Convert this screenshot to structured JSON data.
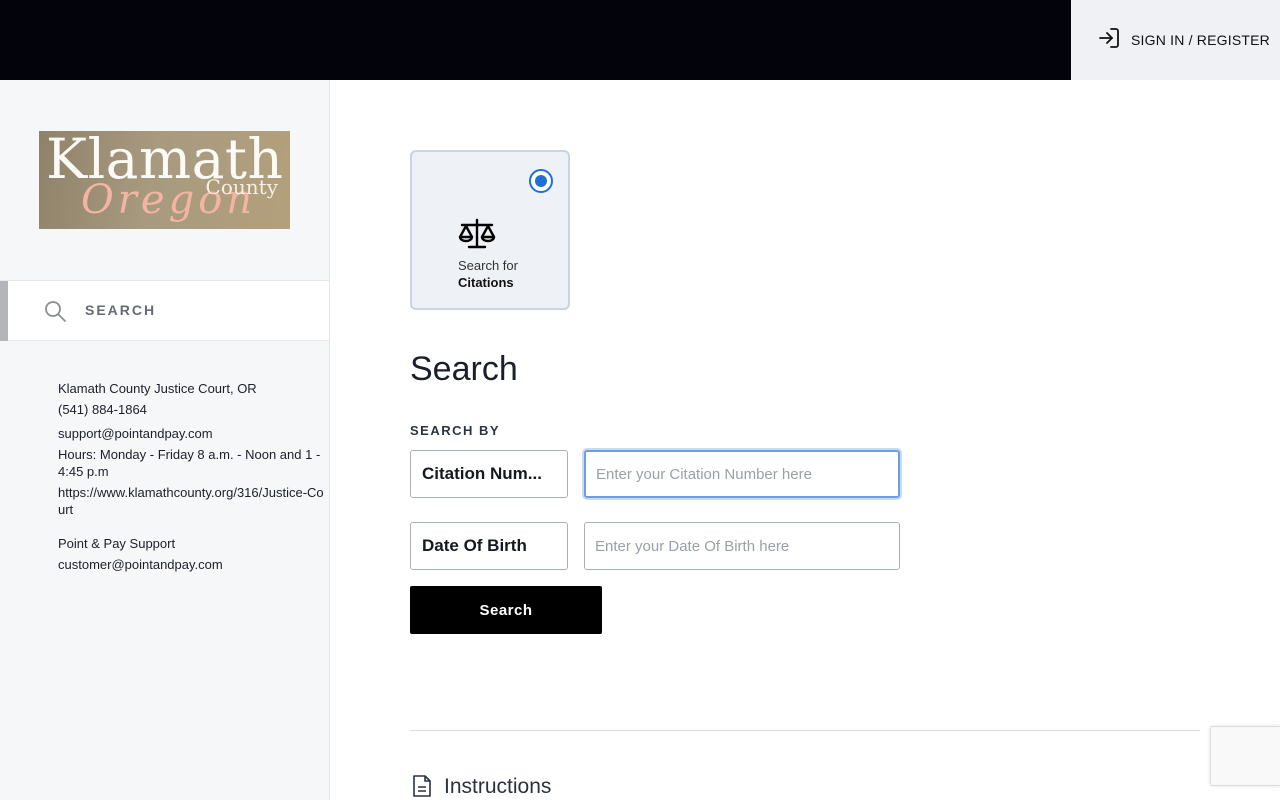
{
  "header": {
    "signin_label": "SIGN IN / REGISTER"
  },
  "sidebar": {
    "logo": {
      "line1": "Klamath",
      "line2": "County",
      "line3": "Oregon"
    },
    "search_label": "SEARCH",
    "info": {
      "court_name": "Klamath County Justice Court, OR",
      "phone": "(541) 884-1864",
      "email": "support@pointandpay.com",
      "hours": "Hours: Monday - Friday 8 a.m. - Noon and 1 - 4:45 p.m",
      "website": "https://www.klamathcounty.org/316/Justice-Court",
      "support_title": "Point & Pay Support",
      "support_email": "customer@pointandpay.com"
    }
  },
  "main": {
    "card": {
      "label_line1": "Search for",
      "label_line2": "Citations",
      "selected": true
    },
    "title": "Search",
    "search_by_label": "SEARCH BY",
    "fields": [
      {
        "selector_label": "Citation Num...",
        "placeholder": "Enter your Citation Number here",
        "value": ""
      },
      {
        "selector_label": "Date Of Birth",
        "placeholder": "Enter your Date Of Birth here",
        "value": ""
      }
    ],
    "search_button": "Search",
    "instructions_label": "Instructions"
  },
  "icons": {
    "signin": "sign-in-arrow-icon",
    "search": "magnifier-icon",
    "card": "scales-of-justice-icon",
    "instructions": "document-icon"
  },
  "colors": {
    "topbar": "#03040b",
    "accent_blue": "#1e6fd9",
    "button": "#000000"
  }
}
